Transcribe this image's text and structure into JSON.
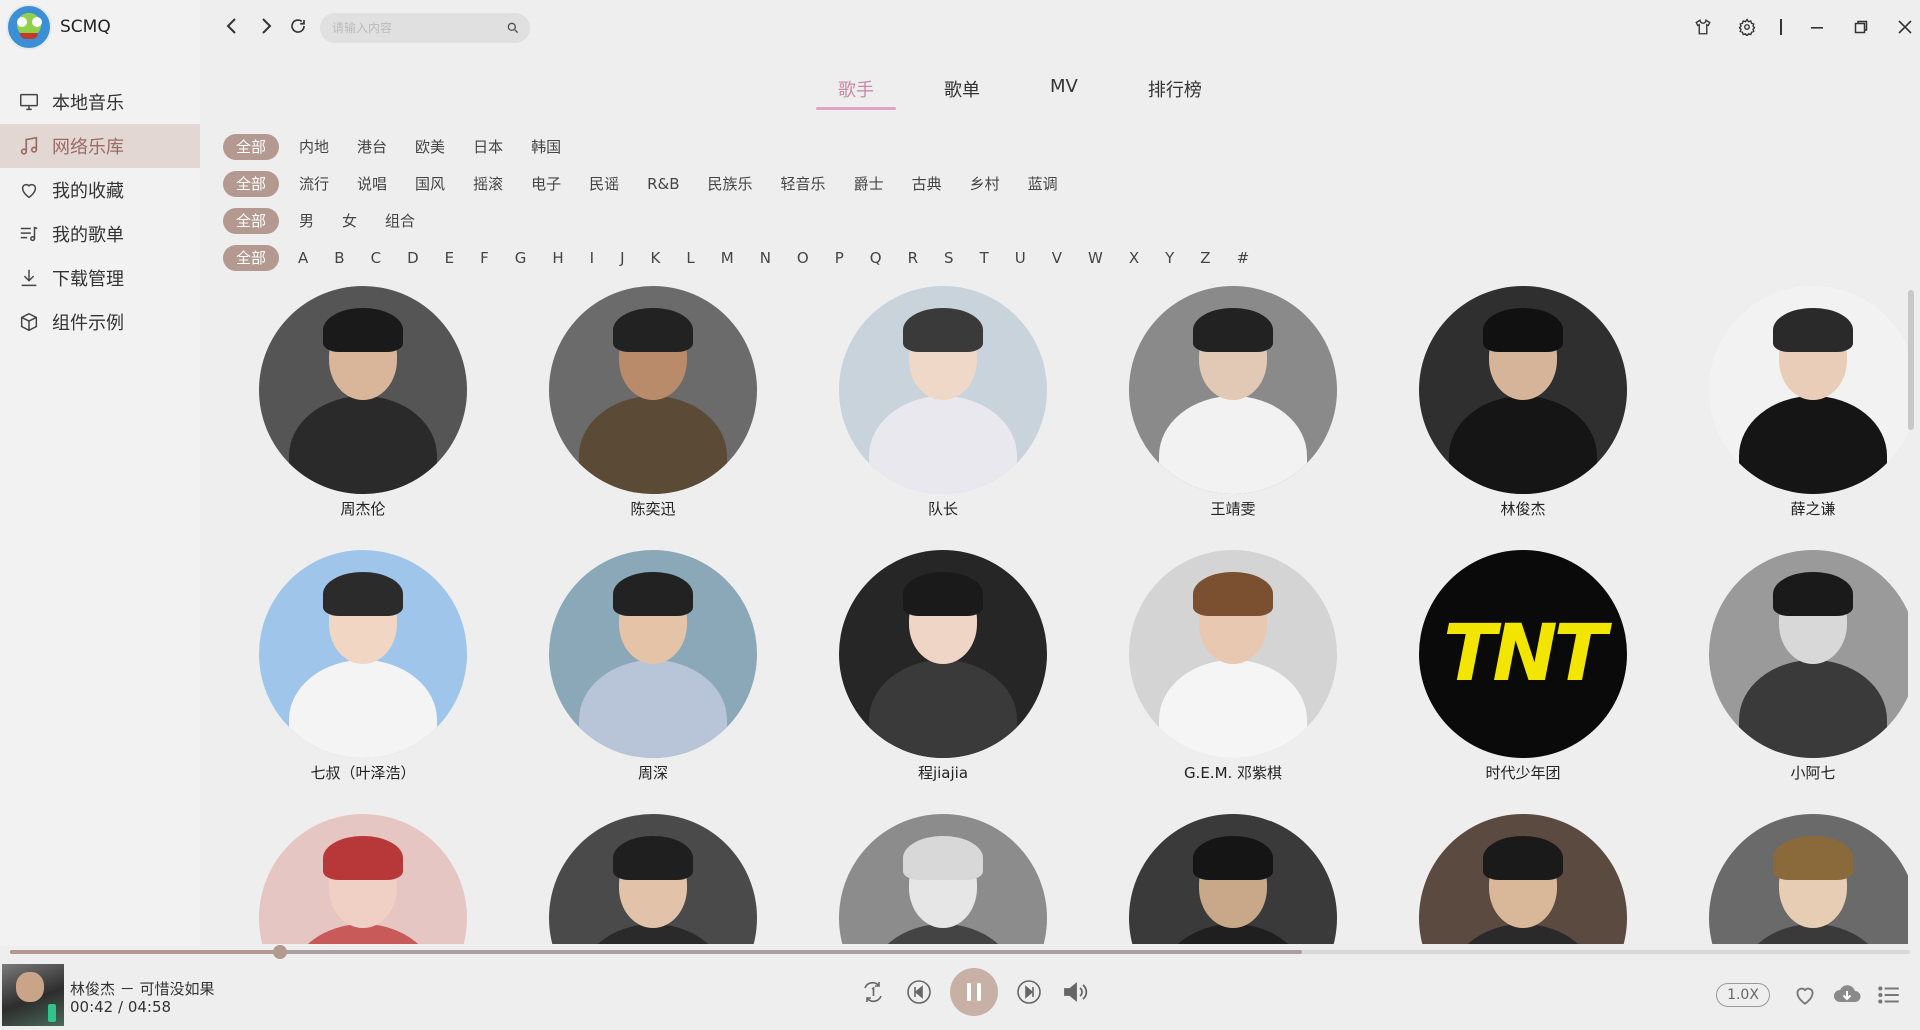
{
  "app": {
    "name": "SCMQ"
  },
  "sidebar": {
    "items": [
      {
        "label": "本地音乐",
        "icon": "monitor-icon"
      },
      {
        "label": "网络乐库",
        "icon": "music-note-icon",
        "active": true
      },
      {
        "label": "我的收藏",
        "icon": "heart-icon"
      },
      {
        "label": "我的歌单",
        "icon": "playlist-icon"
      },
      {
        "label": "下载管理",
        "icon": "download-icon"
      },
      {
        "label": "组件示例",
        "icon": "cube-icon"
      }
    ]
  },
  "search": {
    "placeholder": "请输入内容"
  },
  "tabs": [
    {
      "label": "歌手",
      "active": true
    },
    {
      "label": "歌单"
    },
    {
      "label": "MV"
    },
    {
      "label": "排行榜"
    }
  ],
  "filters": {
    "all_label": "全部",
    "region": [
      "内地",
      "港台",
      "欧美",
      "日本",
      "韩国"
    ],
    "genre": [
      "流行",
      "说唱",
      "国风",
      "摇滚",
      "电子",
      "民谣",
      "R&B",
      "民族乐",
      "轻音乐",
      "爵士",
      "古典",
      "乡村",
      "蓝调"
    ],
    "gender": [
      "男",
      "女",
      "组合"
    ],
    "letters": [
      "A",
      "B",
      "C",
      "D",
      "E",
      "F",
      "G",
      "H",
      "I",
      "J",
      "K",
      "L",
      "M",
      "N",
      "O",
      "P",
      "Q",
      "R",
      "S",
      "T",
      "U",
      "V",
      "W",
      "X",
      "Y",
      "Z",
      "#"
    ]
  },
  "singers": [
    {
      "name": "周杰伦",
      "bg": "#555555",
      "skin": "#d9b59a",
      "cloth": "#2a2a2a",
      "hair": "#1a1a1a"
    },
    {
      "name": "陈奕迅",
      "bg": "#6b6b6b",
      "skin": "#b98b6a",
      "cloth": "#5b4a35",
      "hair": "#222222"
    },
    {
      "name": "队长",
      "bg": "#c9d3dc",
      "skin": "#f0d8c8",
      "cloth": "#e8e8ee",
      "hair": "#3a3a3a"
    },
    {
      "name": "王靖雯",
      "bg": "#8a8a8a",
      "skin": "#e2c9b5",
      "cloth": "#f2f2f2",
      "hair": "#222222"
    },
    {
      "name": "林俊杰",
      "bg": "#2f2f2f",
      "skin": "#d6b49a",
      "cloth": "#151515",
      "hair": "#111111"
    },
    {
      "name": "薛之谦",
      "bg": "#f2f2f2",
      "skin": "#e9cdb8",
      "cloth": "#151515",
      "hair": "#2a2a2a"
    },
    {
      "name": "七叔（叶泽浩）",
      "bg": "#9fc6ea",
      "skin": "#f1d6c4",
      "cloth": "#f4f4f4",
      "hair": "#2b2b2b"
    },
    {
      "name": "周深",
      "bg": "#8aa8b8",
      "skin": "#e4c3a6",
      "cloth": "#b8c4d8",
      "hair": "#222222"
    },
    {
      "name": "程jiajia",
      "bg": "#262626",
      "skin": "#eed5c5",
      "cloth": "#3a3a3a",
      "hair": "#1a1a1a"
    },
    {
      "name": "G.E.M. 邓紫棋",
      "bg": "#d4d4d4",
      "skin": "#e8c8b0",
      "cloth": "#f5f5f5",
      "hair": "#7a5030"
    },
    {
      "name": "时代少年团",
      "bg": "#0a0a0a",
      "logo": "TNT"
    },
    {
      "name": "小阿七",
      "bg": "#9a9a9a",
      "skin": "#d8d8d8",
      "cloth": "#3a3a3a",
      "hair": "#1a1a1a"
    },
    {
      "name": "",
      "bg": "#e6c6c2",
      "skin": "#f0d0c4",
      "cloth": "#c85a5a",
      "hair": "#b8383a"
    },
    {
      "name": "",
      "bg": "#4a4a4a",
      "skin": "#e2c2a8",
      "cloth": "#2a2a2a",
      "hair": "#1f1f1f"
    },
    {
      "name": "",
      "bg": "#8c8c8c",
      "skin": "#e6e6e6",
      "cloth": "#444444",
      "hair": "#d8d8d8"
    },
    {
      "name": "",
      "bg": "#3a3a3a",
      "skin": "#c8a888",
      "cloth": "#1f1f1f",
      "hair": "#151515"
    },
    {
      "name": "",
      "bg": "#5a4a40",
      "skin": "#d8b898",
      "cloth": "#2a2a2a",
      "hair": "#1a1a1a"
    },
    {
      "name": "",
      "bg": "#6a6a6a",
      "skin": "#e8cdb5",
      "cloth": "#3a3a3a",
      "hair": "#8a6a3a"
    }
  ],
  "player": {
    "track": "林俊杰 － 可惜没如果",
    "time": "00:42 / 04:58",
    "speed": "1.0X",
    "progress": 0.142,
    "buffered": 0.68
  },
  "colors": {
    "accent": "#b3998f",
    "tab_active": "#c98aa7",
    "sidebar_active": "#e2d7d3"
  }
}
